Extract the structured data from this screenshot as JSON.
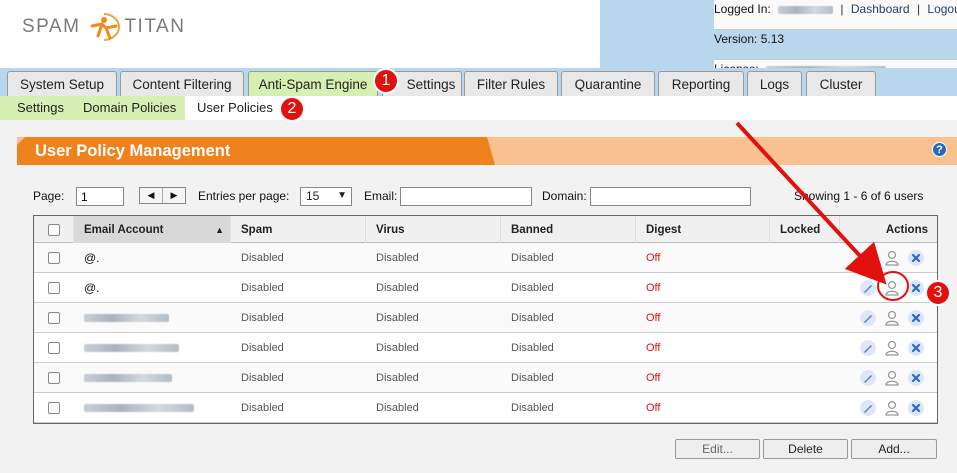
{
  "header": {
    "logo_left": "SPAM",
    "logo_right": "TITAN",
    "logged_in_label": "Logged In:",
    "dashboard_link": "Dashboard",
    "logout_link": "Logout",
    "version_label": "Version:",
    "version_value": "5.13",
    "license_label": "License:"
  },
  "main_tabs": [
    "System Setup",
    "Content Filtering",
    "Anti-Spam Engine",
    "Settings",
    "Filter Rules",
    "Quarantine",
    "Reporting",
    "Logs",
    "Cluster"
  ],
  "sub_tabs": [
    "Settings",
    "Domain Policies",
    "User Policies"
  ],
  "badges": [
    "1",
    "2",
    "3"
  ],
  "panel": {
    "title": "User Policy Management",
    "help_icon": "?"
  },
  "toolbar": {
    "page_label": "Page:",
    "page_value": "1",
    "entries_label": "Entries per page:",
    "entries_value": "15",
    "email_label": "Email:",
    "email_value": "",
    "domain_label": "Domain:",
    "domain_value": "",
    "showing_text": "Showing 1 - 6 of 6 users"
  },
  "table": {
    "columns": [
      "Email Account",
      "Spam",
      "Virus",
      "Banned",
      "Digest",
      "Locked",
      "Actions"
    ],
    "rows": [
      {
        "email": "@.",
        "spam": "Disabled",
        "virus": "Disabled",
        "banned": "Disabled",
        "digest": "Off",
        "locked": ""
      },
      {
        "email": "@.",
        "spam": "Disabled",
        "virus": "Disabled",
        "banned": "Disabled",
        "digest": "Off",
        "locked": ""
      },
      {
        "email": "",
        "spam": "Disabled",
        "virus": "Disabled",
        "banned": "Disabled",
        "digest": "Off",
        "locked": ""
      },
      {
        "email": "",
        "spam": "Disabled",
        "virus": "Disabled",
        "banned": "Disabled",
        "digest": "Off",
        "locked": ""
      },
      {
        "email": "",
        "spam": "Disabled",
        "virus": "Disabled",
        "banned": "Disabled",
        "digest": "Off",
        "locked": ""
      },
      {
        "email": "",
        "spam": "Disabled",
        "virus": "Disabled",
        "banned": "Disabled",
        "digest": "Off",
        "locked": ""
      }
    ]
  },
  "buttons": {
    "edit": "Edit...",
    "delete": "Delete",
    "add": "Add..."
  },
  "colors": {
    "accent_orange": "#f0821e",
    "tab_active": "#d6efb2",
    "header_blue": "#b9d7ec",
    "badge_red": "#e31010"
  }
}
